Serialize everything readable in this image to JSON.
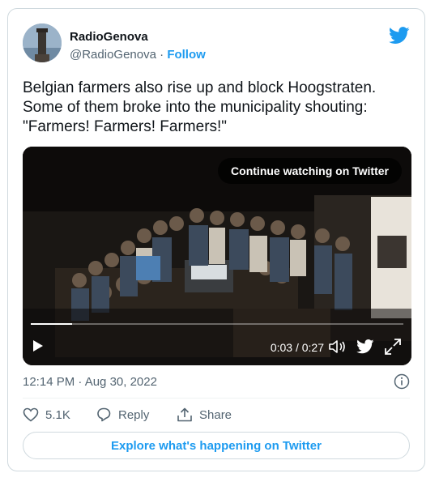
{
  "author": {
    "name": "RadioGenova",
    "handle": "@RadioGenova",
    "separator": "·",
    "follow_label": "Follow"
  },
  "tweet": {
    "text": "Belgian farmers also rise up and block Hoogstraten. Some of them broke into the municipality shouting: \"Farmers! Farmers! Farmers!\"",
    "timestamp": "12:14 PM · Aug 30, 2022"
  },
  "video": {
    "continue_label": "Continue watching on Twitter",
    "time": "0:03 / 0:27",
    "progress": 0.11
  },
  "actions": {
    "likes": "5.1K",
    "reply_label": "Reply",
    "share_label": "Share"
  },
  "explore_label": "Explore what's happening on Twitter",
  "colors": {
    "accent": "#1d9bf0",
    "text": "#0f1419",
    "muted": "#536471",
    "border": "#cfd9de"
  },
  "icons": [
    "twitter-bird-icon",
    "play-icon",
    "volume-icon",
    "expand-icon",
    "info-icon",
    "heart-icon",
    "reply-icon",
    "share-icon"
  ]
}
